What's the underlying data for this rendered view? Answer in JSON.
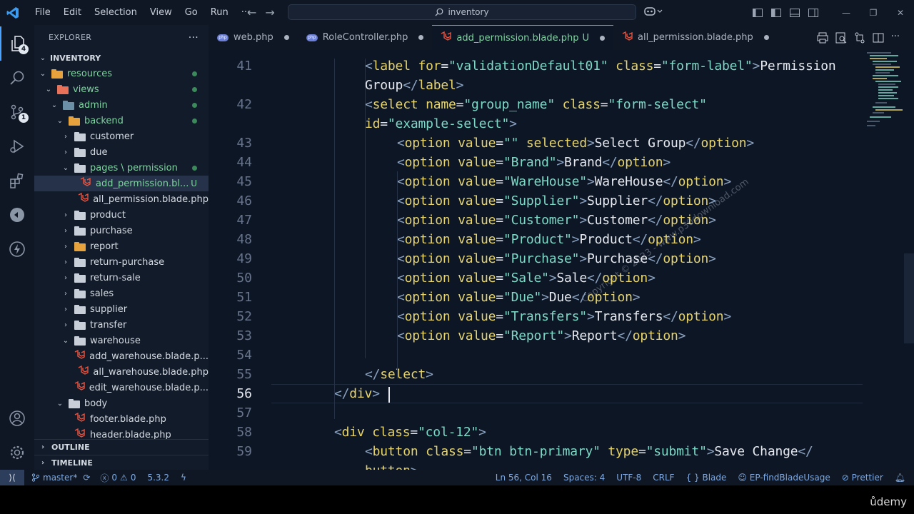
{
  "menu": [
    "File",
    "Edit",
    "Selection",
    "View",
    "Go",
    "Run",
    "···"
  ],
  "search": {
    "text": "inventory"
  },
  "explorer": {
    "title": "EXPLORER",
    "more": "···",
    "root": "INVENTORY",
    "items": [
      {
        "label": "resources",
        "kind": "folder-orange",
        "open": true,
        "depth": 1,
        "mark": "dot",
        "color": "green"
      },
      {
        "label": "views",
        "kind": "folder-red",
        "open": true,
        "depth": 2,
        "mark": "dot",
        "color": "green"
      },
      {
        "label": "admin",
        "kind": "folder-teal",
        "open": true,
        "depth": 3,
        "mark": "dot",
        "color": "green"
      },
      {
        "label": "backend",
        "kind": "folder-orange",
        "open": true,
        "depth": 4,
        "mark": "dot",
        "color": "green"
      },
      {
        "label": "customer",
        "kind": "folder",
        "open": false,
        "depth": 5
      },
      {
        "label": "due",
        "kind": "folder",
        "open": false,
        "depth": 5
      },
      {
        "label": "pages \\ permission",
        "kind": "folder",
        "open": true,
        "depth": 5,
        "mark": "dot",
        "color": "green"
      },
      {
        "label": "add_permission.bl...",
        "kind": "blade",
        "depth": 6,
        "mark": "U",
        "color": "green",
        "selected": true
      },
      {
        "label": "all_permission.blade.php",
        "kind": "blade",
        "depth": 6
      },
      {
        "label": "product",
        "kind": "folder",
        "open": false,
        "depth": 5
      },
      {
        "label": "purchase",
        "kind": "folder",
        "open": false,
        "depth": 5
      },
      {
        "label": "report",
        "kind": "folder-orange",
        "open": false,
        "depth": 5
      },
      {
        "label": "return-purchase",
        "kind": "folder",
        "open": false,
        "depth": 5
      },
      {
        "label": "return-sale",
        "kind": "folder",
        "open": false,
        "depth": 5
      },
      {
        "label": "sales",
        "kind": "folder",
        "open": false,
        "depth": 5
      },
      {
        "label": "supplier",
        "kind": "folder",
        "open": false,
        "depth": 5
      },
      {
        "label": "transfer",
        "kind": "folder",
        "open": false,
        "depth": 5
      },
      {
        "label": "warehouse",
        "kind": "folder",
        "open": true,
        "depth": 5
      },
      {
        "label": "add_warehouse.blade.p...",
        "kind": "blade",
        "depth": 6
      },
      {
        "label": "all_warehouse.blade.php",
        "kind": "blade",
        "depth": 6
      },
      {
        "label": "edit_warehouse.blade.p...",
        "kind": "blade",
        "depth": 6
      },
      {
        "label": "body",
        "kind": "folder",
        "open": true,
        "depth": 4
      },
      {
        "label": "footer.blade.php",
        "kind": "blade",
        "depth": 5
      },
      {
        "label": "header.blade.php",
        "kind": "blade",
        "depth": 5
      }
    ],
    "outline": "OUTLINE",
    "timeline": "TIMELINE"
  },
  "activity_badges": {
    "explorer": "4",
    "scm": "1"
  },
  "tabs": [
    {
      "label": "web.php",
      "icon": "php",
      "active": false,
      "dot": true
    },
    {
      "label": "RoleController.php",
      "icon": "php",
      "active": false,
      "dot": true
    },
    {
      "label": "add_permission.blade.php",
      "suffix": "U",
      "icon": "blade",
      "active": true,
      "dot": true
    },
    {
      "label": "all_permission.blade.php",
      "icon": "blade",
      "active": false,
      "dot": true
    }
  ],
  "editor": {
    "current_line": 56,
    "lines": [
      {
        "n": "41",
        "indent": 1,
        "html": "label_open"
      },
      {
        "n": "",
        "indent": 1,
        "html": "label_close"
      },
      {
        "n": "42",
        "indent": 1,
        "html": "select_open"
      },
      {
        "n": "",
        "indent": 1,
        "html": "select_id"
      },
      {
        "n": "43",
        "indent": 2,
        "opt": [
          "",
          "Select Group"
        ],
        "selected": true
      },
      {
        "n": "44",
        "indent": 2,
        "opt": [
          "Brand",
          "Brand"
        ]
      },
      {
        "n": "45",
        "indent": 2,
        "opt": [
          "WareHouse",
          "WareHouse"
        ]
      },
      {
        "n": "46",
        "indent": 2,
        "opt": [
          "Supplier",
          "Supplier"
        ]
      },
      {
        "n": "47",
        "indent": 2,
        "opt": [
          "Customer",
          "Customer"
        ]
      },
      {
        "n": "48",
        "indent": 2,
        "opt": [
          "Product",
          "Product"
        ]
      },
      {
        "n": "49",
        "indent": 2,
        "opt": [
          "Purchase",
          "Purchase"
        ]
      },
      {
        "n": "50",
        "indent": 2,
        "opt": [
          "Sale",
          "Sale"
        ]
      },
      {
        "n": "51",
        "indent": 2,
        "opt": [
          "Due",
          "Due"
        ]
      },
      {
        "n": "52",
        "indent": 2,
        "opt": [
          "Transfers",
          "Transfers"
        ]
      },
      {
        "n": "53",
        "indent": 2,
        "opt": [
          "Report",
          "Report"
        ]
      },
      {
        "n": "54",
        "indent": 0,
        "html": "empty"
      },
      {
        "n": "55",
        "indent": 1,
        "html": "select_close"
      },
      {
        "n": "56",
        "indent": 0,
        "html": "div_close"
      },
      {
        "n": "57",
        "indent": 0,
        "html": "empty"
      },
      {
        "n": "58",
        "indent": 0,
        "html": "div_col12"
      },
      {
        "n": "59",
        "indent": 1,
        "html": "button_open"
      },
      {
        "n": "",
        "indent": 1,
        "html": "button_close"
      }
    ],
    "strings": {
      "label_for": "validationDefault01",
      "label_class": "form-label",
      "label_text": "Permission",
      "label_text2": "Group",
      "select_name": "group_name",
      "select_class": "form-select",
      "select_id": "example-select",
      "div_class": "col-12",
      "btn_class": "btn btn-primary",
      "btn_type": "submit",
      "btn_text": "Save Change"
    },
    "watermark": "Copyright © 2023 - www.p30download.com"
  },
  "status": {
    "branch": "master*",
    "errors": "0",
    "warnings": "0",
    "version": "5.3.2",
    "position": "Ln 56, Col 16",
    "spaces": "Spaces: 4",
    "encoding": "UTF-8",
    "eol": "CRLF",
    "language": "Blade",
    "extension": "EP-findBladeUsage",
    "formatter": "Prettier"
  },
  "udemy": "ůdemy",
  "colors": {
    "accent": "#4aa3ff",
    "git_green": "#7fd3a0",
    "blade_red": "#f0533d",
    "string": "#7ed8c6",
    "attr": "#e6d36b"
  }
}
